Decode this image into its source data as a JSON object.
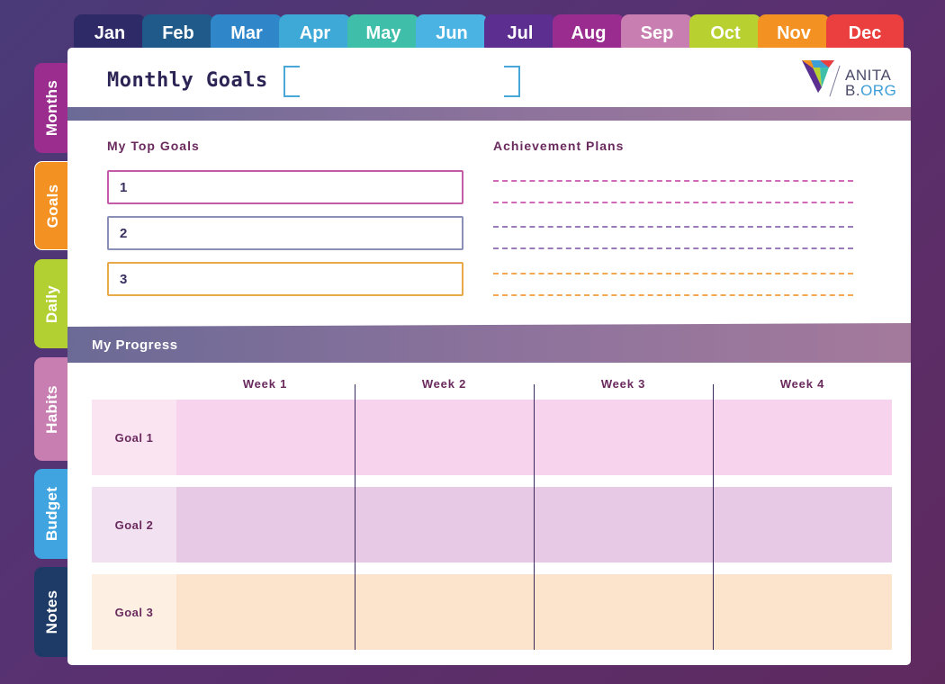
{
  "months": [
    {
      "label": "Jan",
      "color": "#2e2a68"
    },
    {
      "label": "Feb",
      "color": "#1f5a8a"
    },
    {
      "label": "Mar",
      "color": "#2f86c9"
    },
    {
      "label": "Apr",
      "color": "#3ea9d6"
    },
    {
      "label": "May",
      "color": "#3fbfa9"
    },
    {
      "label": "Jun",
      "color": "#4ab3e3"
    },
    {
      "label": "Jul",
      "color": "#5b2e8f"
    },
    {
      "label": "Aug",
      "color": "#9a2c8f"
    },
    {
      "label": "Sep",
      "color": "#c87eb0"
    },
    {
      "label": "Oct",
      "color": "#b8d130"
    },
    {
      "label": "Nov",
      "color": "#f39222"
    },
    {
      "label": "Dec",
      "color": "#eb3e3e"
    }
  ],
  "side_tabs": [
    {
      "label": "Months",
      "color": "#9b2d8f",
      "active": false
    },
    {
      "label": "Goals",
      "color": "#f39222",
      "active": true
    },
    {
      "label": "Daily",
      "color": "#b3d033",
      "active": false
    },
    {
      "label": "Habits",
      "color": "#c87eb0",
      "active": false
    },
    {
      "label": "Budget",
      "color": "#3fa4df",
      "active": false
    },
    {
      "label": "Notes",
      "color": "#1e3a66",
      "active": false
    }
  ],
  "page": {
    "title": "Monthly Goals",
    "month_input_value": ""
  },
  "logo": {
    "line1": "ANITA",
    "line2_prefix": "B.",
    "line2_suffix": "ORG"
  },
  "top_goals": {
    "heading": "My Top Goals",
    "items": [
      {
        "number": "1",
        "border": "#c45ba8"
      },
      {
        "number": "2",
        "border": "#8a8fb8"
      },
      {
        "number": "3",
        "border": "#e9a94a"
      }
    ]
  },
  "achievement_plans": {
    "heading": "Achievement Plans",
    "line_colors": [
      "#d06ab8",
      "#d06ab8",
      "#9a7ab8",
      "#9a7ab8",
      "#f1a850",
      "#f1a850"
    ]
  },
  "progress": {
    "heading": "My Progress",
    "weeks": [
      "Week 1",
      "Week 2",
      "Week 3",
      "Week 4"
    ],
    "goals": [
      {
        "label": "Goal 1",
        "label_bg": "#fbe4f2",
        "cell_bg": "#f8d3ed"
      },
      {
        "label": "Goal 2",
        "label_bg": "#f1e1f1",
        "cell_bg": "#e7c8e5"
      },
      {
        "label": "Goal 3",
        "label_bg": "#fdf0e3",
        "cell_bg": "#fce3cb"
      }
    ]
  }
}
